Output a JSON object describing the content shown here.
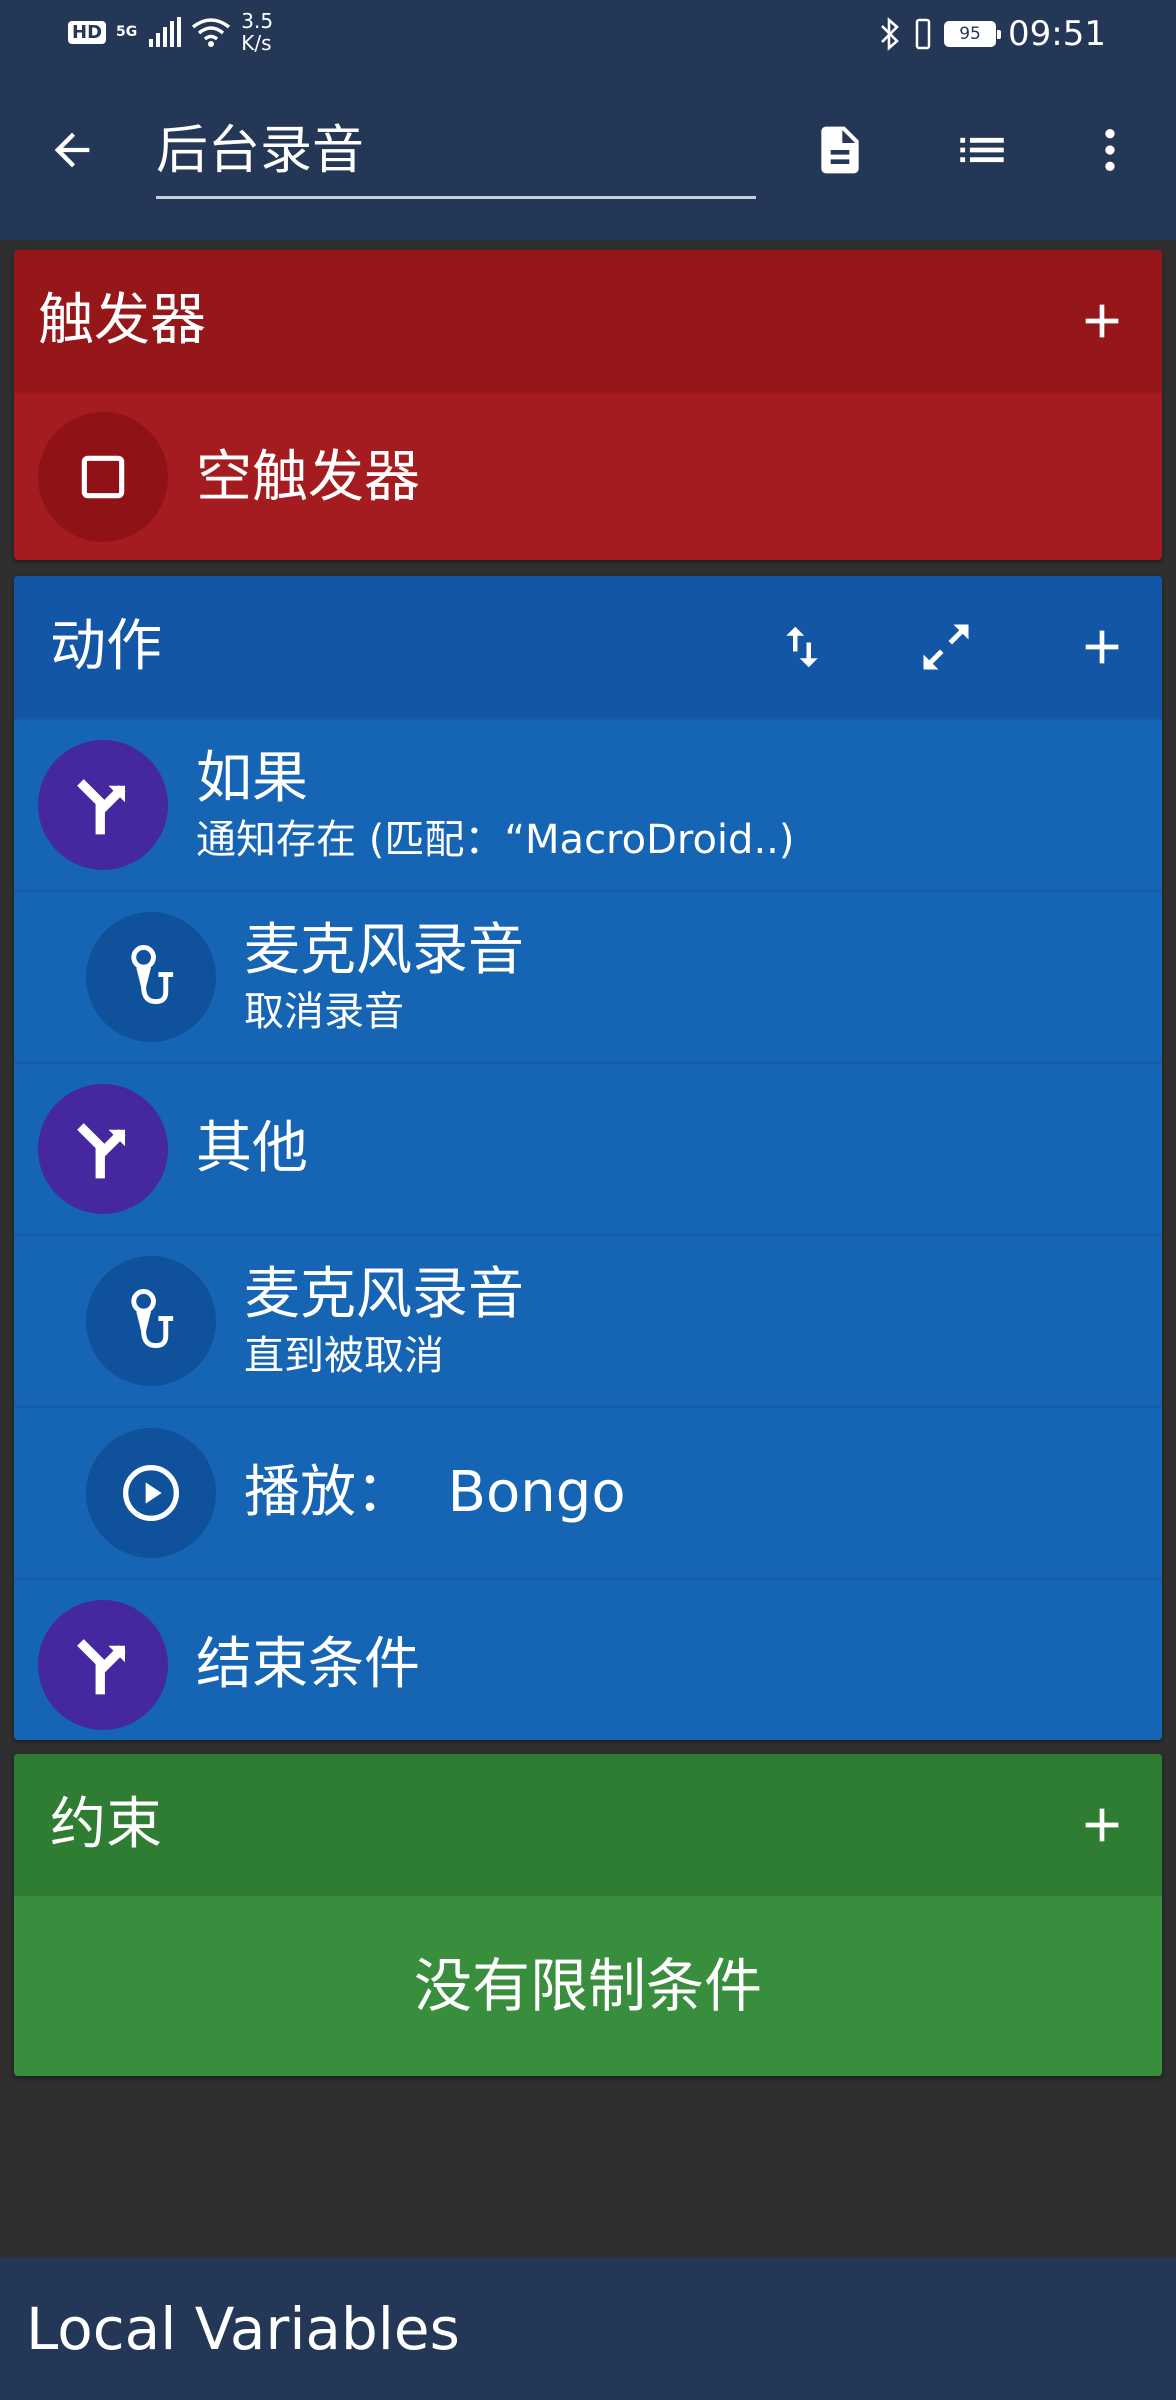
{
  "status_bar": {
    "hd": "HD",
    "network": "5G",
    "speed_value": "3.5",
    "speed_unit": "K/s",
    "battery": "95",
    "time": "09:51"
  },
  "app_bar": {
    "title": "后台录音",
    "icons": [
      "back-arrow-icon",
      "document-icon",
      "list-icon",
      "more-vert-icon"
    ]
  },
  "triggers": {
    "title": "触发器",
    "items": [
      {
        "label": "空触发器",
        "icon": "square-icon"
      }
    ]
  },
  "actions": {
    "title": "动作",
    "items": [
      {
        "label": "如果",
        "detail": "通知存在 (匹配：“MacroDroid..)",
        "icon": "branch-icon",
        "level": 0
      },
      {
        "label": "麦克风录音",
        "detail": "取消录音",
        "icon": "microphone-icon",
        "level": 1
      },
      {
        "label": "其他",
        "detail": "",
        "icon": "branch-icon",
        "level": 0
      },
      {
        "label": "麦克风录音",
        "detail": "直到被取消",
        "icon": "microphone-icon",
        "level": 1
      },
      {
        "label": "播放：  Bongo",
        "detail": "",
        "icon": "play-circle-icon",
        "level": 1
      },
      {
        "label": "结束条件",
        "detail": "",
        "icon": "branch-icon",
        "level": 0
      }
    ]
  },
  "constraints": {
    "title": "约束",
    "empty_text": "没有限制条件"
  },
  "bottom": {
    "title": "Local Variables"
  },
  "colors": {
    "app_bar": "#243756",
    "trigger_header": "#95171a",
    "trigger_body": "#a51c20",
    "action_header": "#1356a6",
    "action_body": "#1565b4",
    "constraint_header": "#2e7d32",
    "constraint_body": "#388e3c",
    "branch_circle": "#4527a0"
  }
}
